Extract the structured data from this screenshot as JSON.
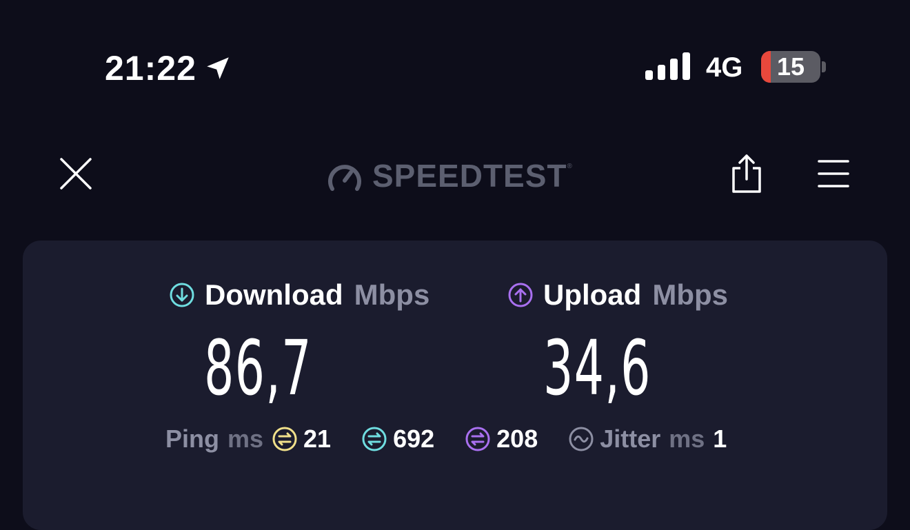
{
  "status_bar": {
    "time": "21:22",
    "network": "4G",
    "battery_level": "15",
    "icons": [
      "location-arrow-icon",
      "signal-bars-icon",
      "battery-icon"
    ]
  },
  "header": {
    "logo_text": "SPEEDTEST",
    "logo_mark": "®",
    "icons": [
      "close-icon",
      "speedometer-icon",
      "share-icon",
      "menu-icon"
    ]
  },
  "results": {
    "download": {
      "label": "Download",
      "unit": "Mbps",
      "value": "86,7",
      "icon": "download-arrow-icon",
      "color": "#6fdde0"
    },
    "upload": {
      "label": "Upload",
      "unit": "Mbps",
      "value": "34,6",
      "icon": "upload-arrow-icon",
      "color": "#a970f0"
    },
    "ping": {
      "label": "Ping",
      "unit": "ms",
      "idle": {
        "value": "21",
        "icon": "ping-idle-icon",
        "color": "#f0e08a"
      },
      "download": {
        "value": "692",
        "icon": "ping-download-icon",
        "color": "#6fdde0"
      },
      "upload": {
        "value": "208",
        "icon": "ping-upload-icon",
        "color": "#a970f0"
      }
    },
    "jitter": {
      "label": "Jitter",
      "unit": "ms",
      "value": "1",
      "icon": "jitter-icon",
      "color": "#8d8fa3"
    }
  }
}
